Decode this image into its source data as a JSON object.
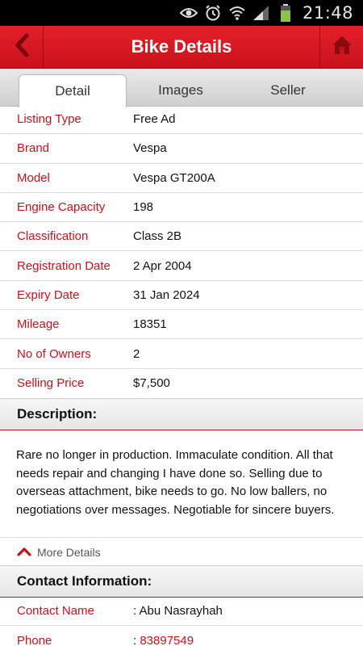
{
  "statusbar": {
    "time": "21:48"
  },
  "appbar": {
    "title": "Bike Details"
  },
  "tabs": [
    {
      "label": "Detail"
    },
    {
      "label": "Images"
    },
    {
      "label": "Seller"
    }
  ],
  "details": [
    {
      "label": "Listing Type",
      "value": "Free Ad"
    },
    {
      "label": "Brand",
      "value": "Vespa"
    },
    {
      "label": "Model",
      "value": "Vespa GT200A"
    },
    {
      "label": "Engine Capacity",
      "value": "198"
    },
    {
      "label": "Classification",
      "value": "Class 2B"
    },
    {
      "label": "Registration Date",
      "value": "2 Apr 2004"
    },
    {
      "label": "Expiry Date",
      "value": "31 Jan 2024"
    },
    {
      "label": "Mileage",
      "value": "18351"
    },
    {
      "label": "No of Owners",
      "value": "2"
    },
    {
      "label": "Selling Price",
      "value": "$7,500"
    }
  ],
  "description": {
    "heading": "Description:",
    "text": "Rare no longer in production. Immaculate condition. All that needs repair and changing I have done so. Selling due to overseas attachment, bike needs to go. No low ballers, no negotiations over messages. Negotiable for sincere buyers."
  },
  "more_details": {
    "label": "More Details"
  },
  "contact": {
    "heading": "Contact Information:",
    "name_label": "Contact Name",
    "name_value": ": Abu Nasrayhah",
    "phone_label": "Phone",
    "phone_sep": ": ",
    "phone_value": "83897549"
  },
  "colors": {
    "accent": "#c8101a",
    "appbar": "#d81820"
  }
}
